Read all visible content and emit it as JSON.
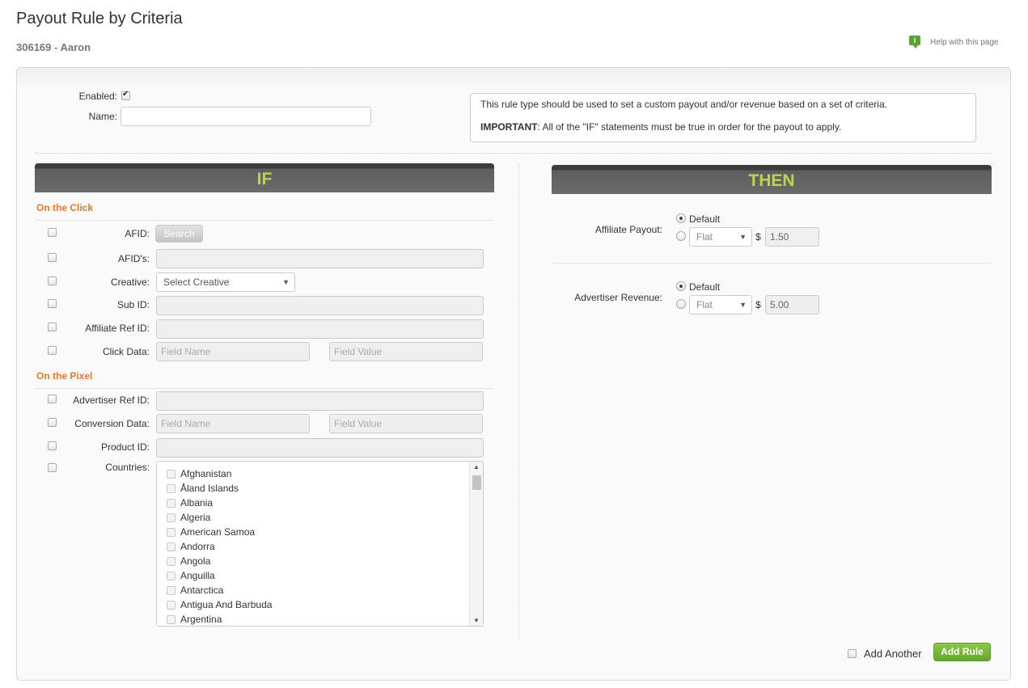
{
  "page": {
    "title": "Payout Rule by Criteria",
    "subtitle": "306169 - Aaron",
    "help_icon_glyph": "i",
    "help_label": "Help with this page"
  },
  "form": {
    "enabled_label": "Enabled:",
    "name_label": "Name:",
    "name_value": ""
  },
  "info": {
    "line1": "This rule type should be used to set a custom payout and/or revenue based on a set of criteria.",
    "important_label": "IMPORTANT",
    "line2": ": All of the \"IF\" statements must be true in order for the payout to apply."
  },
  "if_section": {
    "header": "IF",
    "click_title": "On the Click",
    "afid_label": "AFID:",
    "search_label": "Search",
    "afids_label": "AFID's:",
    "creative_label": "Creative:",
    "creative_value": "Select Creative",
    "subid_label": "Sub ID:",
    "affref_label": "Affiliate Ref ID:",
    "clickdata_label": "Click Data:",
    "field_name_placeholder": "Field Name",
    "field_value_placeholder": "Field Value",
    "pixel_title": "On the Pixel",
    "advref_label": "Advertiser Ref ID:",
    "convdata_label": "Conversion Data:",
    "product_label": "Product ID:",
    "countries_label": "Countries:",
    "countries": [
      "Afghanistan",
      "Åland Islands",
      "Albania",
      "Algeria",
      "American Samoa",
      "Andorra",
      "Angola",
      "Anguilla",
      "Antarctica",
      "Antigua And Barbuda",
      "Argentina"
    ]
  },
  "then_section": {
    "header": "THEN",
    "affiliate_payout_label": "Affiliate Payout:",
    "advertiser_revenue_label": "Advertiser Revenue:",
    "default_label": "Default",
    "flat_label": "Flat",
    "currency": "$",
    "payout_value": "1.50",
    "revenue_value": "5.00"
  },
  "footer": {
    "add_another_label": "Add Another",
    "add_rule_label": "Add Rule"
  },
  "colors": {
    "accent_orange": "#e47a2a",
    "header_green_text": "#b8d74a",
    "button_green": "#62a82b"
  }
}
